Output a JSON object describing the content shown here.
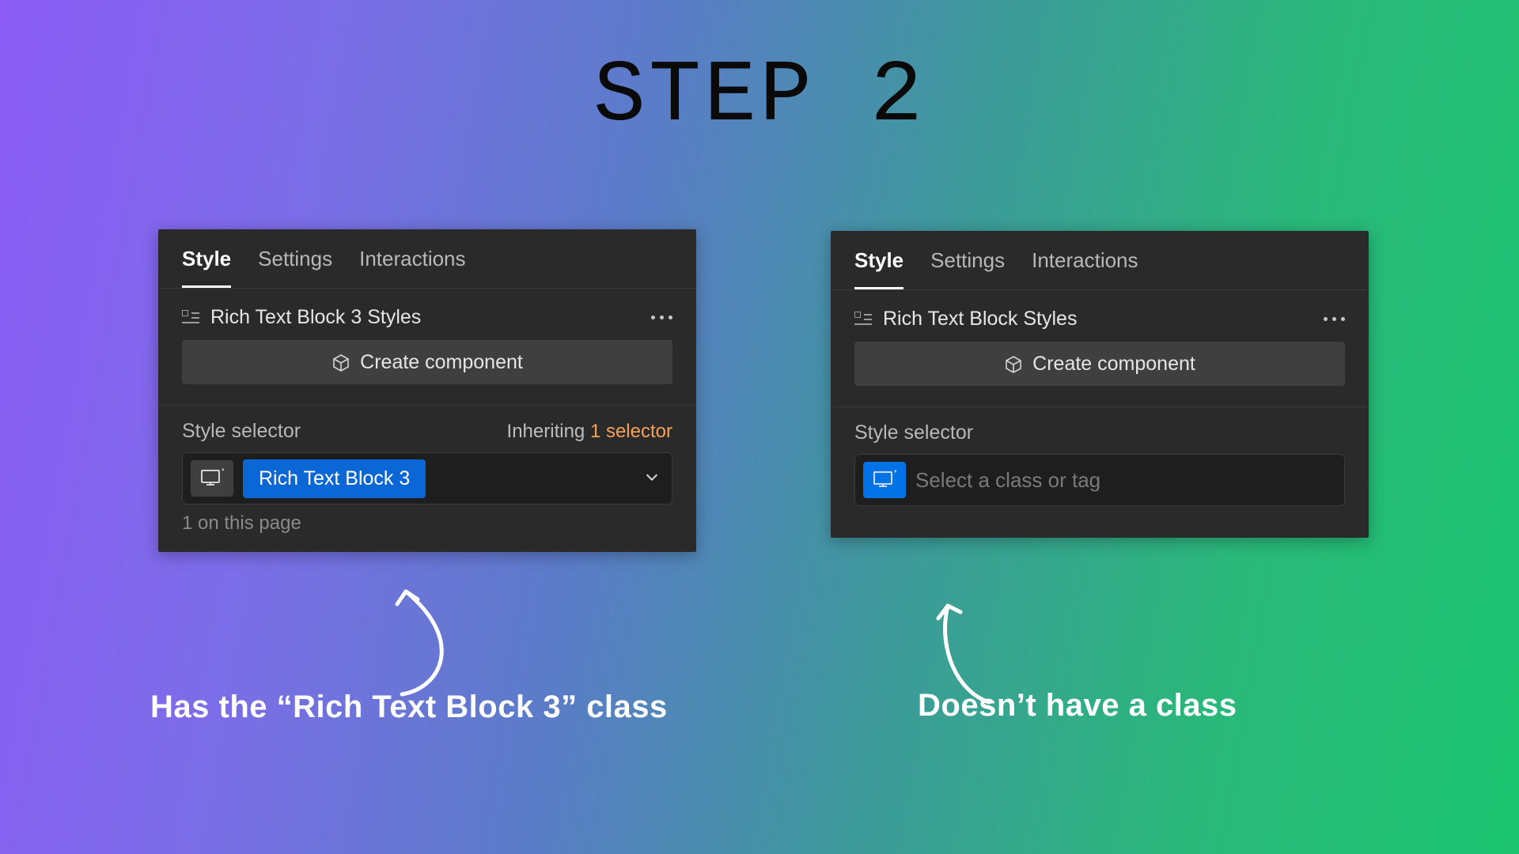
{
  "title": "STEP 2",
  "tabs": {
    "style": "Style",
    "settings": "Settings",
    "interactions": "Interactions"
  },
  "create_component": "Create component",
  "style_selector_label": "Style selector",
  "inheriting_label": "Inheriting",
  "left": {
    "heading": "Rich Text Block 3 Styles",
    "inheriting_count": "1 selector",
    "class_name": "Rich Text Block 3",
    "page_count": "1 on this page"
  },
  "right": {
    "heading": "Rich Text Block Styles",
    "placeholder": "Select a class or tag"
  },
  "captions": {
    "left": "Has the “Rich Text Block 3” class",
    "right": "Doesn’t have a class"
  }
}
